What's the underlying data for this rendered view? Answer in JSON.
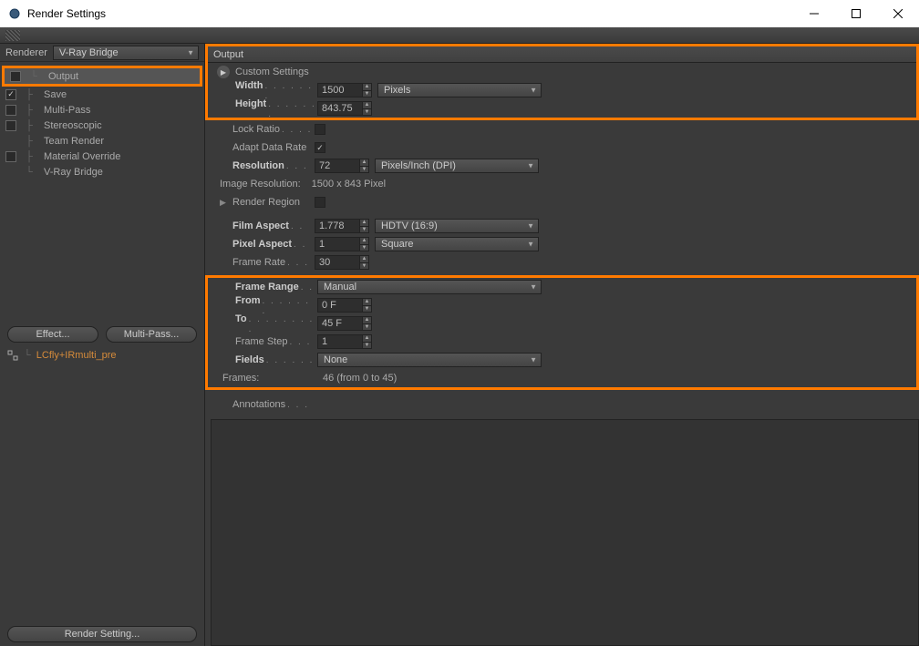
{
  "window": {
    "title": "Render Settings"
  },
  "toolbar": {},
  "renderer": {
    "label": "Renderer",
    "value": "V-Ray Bridge"
  },
  "tree": {
    "output": "Output",
    "save": "Save",
    "multipass": "Multi-Pass",
    "stereo": "Stereoscopic",
    "team": "Team Render",
    "material": "Material Override",
    "vray": "V-Ray Bridge"
  },
  "buttons": {
    "effect": "Effect...",
    "multipass": "Multi-Pass...",
    "render_setting": "Render Setting..."
  },
  "preset": {
    "name": "LCfly+IRmulti_pre"
  },
  "panel": {
    "output_header": "Output",
    "custom": "Custom Settings",
    "width_label": "Width",
    "width_value": "1500",
    "width_unit": "Pixels",
    "height_label": "Height",
    "height_value": "843.75",
    "lock_label": "Lock Ratio",
    "adapt_label": "Adapt Data Rate",
    "res_label": "Resolution",
    "res_value": "72",
    "res_unit": "Pixels/Inch (DPI)",
    "imgres_label": "Image Resolution:",
    "imgres_value": "1500 x 843 Pixel",
    "region_label": "Render Region",
    "film_label": "Film Aspect",
    "film_value": "1.778",
    "film_preset": "HDTV (16:9)",
    "pixel_label": "Pixel Aspect",
    "pixel_value": "1",
    "pixel_preset": "Square",
    "rate_label": "Frame Rate",
    "rate_value": "30",
    "range_label": "Frame Range",
    "range_value": "Manual",
    "from_label": "From",
    "from_value": "0 F",
    "to_label": "To",
    "to_value": "45 F",
    "step_label": "Frame Step",
    "step_value": "1",
    "fields_label": "Fields",
    "fields_value": "None",
    "frames_label": "Frames:",
    "frames_value": "46 (from 0 to 45)",
    "annot_label": "Annotations"
  }
}
